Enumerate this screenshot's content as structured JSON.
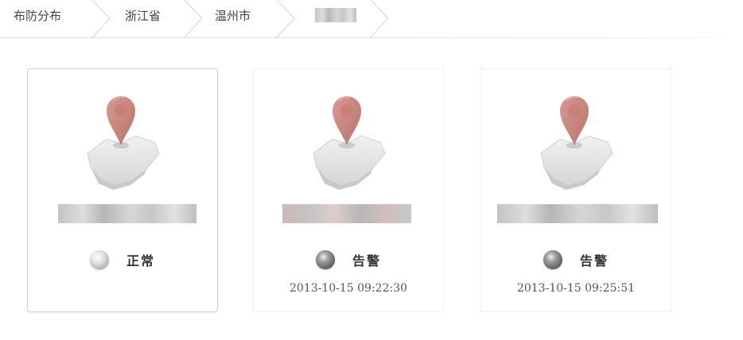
{
  "breadcrumb": {
    "items": [
      {
        "label": "布防分布"
      },
      {
        "label": "浙江省"
      },
      {
        "label": "温州市"
      }
    ]
  },
  "cards": [
    {
      "status_label": "正常",
      "status": "normal",
      "time": ""
    },
    {
      "status_label": "告警",
      "status": "alarm",
      "time": "2013-10-15 09:22:30"
    },
    {
      "status_label": "告警",
      "status": "alarm",
      "time": "2013-10-15 09:25:51"
    }
  ],
  "colors": {
    "pin": "#c9837b",
    "map": "#e4e4e4",
    "border": "#cfcfcf"
  }
}
